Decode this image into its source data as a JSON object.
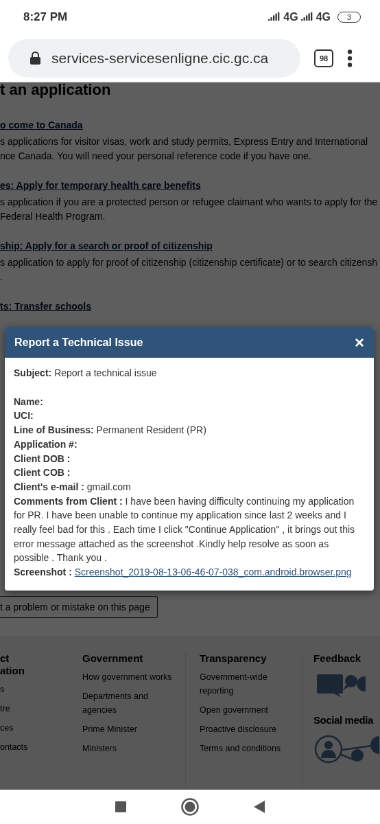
{
  "status_bar": {
    "time": "8:27 PM",
    "networks": [
      "4G",
      "4G"
    ],
    "battery": "3"
  },
  "browser": {
    "url": "services-servicesenligne.cic.gc.ca",
    "tab_count": "98"
  },
  "page": {
    "heading": "t an application",
    "sections": [
      {
        "link": "o come to Canada",
        "lines": [
          "s applications for visitor visas, work and study permits, Express Entry and International",
          "nce Canada. You will need your personal reference code if you have one."
        ]
      },
      {
        "link": "es: Apply for temporary health care benefits",
        "lines": [
          "s application if you are a protected person or refugee claimant who wants to apply for the",
          "Federal Health Program."
        ]
      },
      {
        "link": "ship: Apply for a search or proof of citizenship",
        "lines": [
          "s application to apply for proof of citizenship (citizenship certificate) or to search citizensh",
          "."
        ]
      },
      {
        "link": "ts: Transfer schools"
      }
    ],
    "report_button": "t a problem or mistake on this page",
    "footer": [
      {
        "heading": [
          "ct",
          "ation"
        ],
        "items": [
          [
            "s"
          ],
          [
            "tre"
          ],
          [
            "ces"
          ],
          [
            "ontacts"
          ]
        ]
      },
      {
        "heading": [
          "Government"
        ],
        "items": [
          [
            "How government works"
          ],
          [
            "Departments and",
            "agencies"
          ],
          [
            "Prime Minister"
          ],
          [
            "Ministers"
          ]
        ]
      },
      {
        "heading": [
          "Transparency"
        ],
        "items": [
          [
            "Government-wide",
            "reporting"
          ],
          [
            "Open government"
          ],
          [
            "Proactive disclosure"
          ],
          [
            "Terms and conditions"
          ]
        ]
      }
    ],
    "feedback_heading": "Feedback",
    "social_heading": "Social media"
  },
  "dialog": {
    "title": "Report a Technical Issue",
    "close": "×",
    "subject": {
      "label": "Subject:",
      "value": "Report a technical issue"
    },
    "fields": [
      {
        "label": "Name:"
      },
      {
        "label": "UCI:"
      },
      {
        "label": "Line of Business:",
        "value": "Permanent Resident (PR)"
      },
      {
        "label": "Application #:"
      },
      {
        "label": "Client DOB :"
      },
      {
        "label": "Client COB :"
      },
      {
        "label": "Client's e-mail :",
        "value": "gmail.com"
      },
      {
        "label": "Comments from Client :",
        "value": "I have been having difficulty continuing my application for PR. I have been unable to continue my application since last 2 weeks and I really feel bad for this . Each time I click \"Continue Application\" , it brings out this error message attached as the screenshot .Kindly help resolve as soon as possible . Thank you ."
      }
    ],
    "screenshot": {
      "label": "Screenshot :",
      "link": "Screenshot_2019-08-13-06-46-07-038_com.android.browser.png"
    }
  }
}
